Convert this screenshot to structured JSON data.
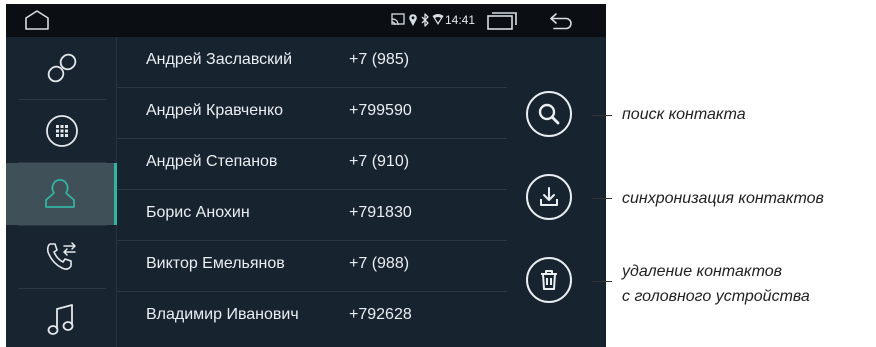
{
  "status_bar": {
    "time": "14:41",
    "icons": [
      "home-icon",
      "cast-icon",
      "location-icon",
      "bluetooth-icon",
      "wifi-icon",
      "recent-apps-icon",
      "back-icon"
    ]
  },
  "navigation": {
    "items": [
      {
        "icon": "link-icon",
        "active": false
      },
      {
        "icon": "dialpad-icon",
        "active": false
      },
      {
        "icon": "contacts-icon",
        "active": true
      },
      {
        "icon": "call-transfer-icon",
        "active": false
      },
      {
        "icon": "music-icon",
        "active": false
      }
    ],
    "accent_color": "#33b3a0"
  },
  "contacts": [
    {
      "name": "Андрей Заславский",
      "phone": "+7 (985)"
    },
    {
      "name": "Андрей Кравченко",
      "phone": "+799590"
    },
    {
      "name": "Андрей Степанов",
      "phone": "+7 (910)"
    },
    {
      "name": "Борис Анохин",
      "phone": "+791830"
    },
    {
      "name": "Виктор Емельянов",
      "phone": "+7 (988)"
    },
    {
      "name": "Владимир Иванович",
      "phone": "+792628"
    }
  ],
  "actions": [
    {
      "icon": "search-icon"
    },
    {
      "icon": "download-icon"
    },
    {
      "icon": "trash-icon"
    }
  ],
  "callouts": {
    "search": "поиск контакта",
    "sync": "синхронизация контактов",
    "delete_line1": "удаление контактов",
    "delete_line2": "с головного устройства"
  }
}
